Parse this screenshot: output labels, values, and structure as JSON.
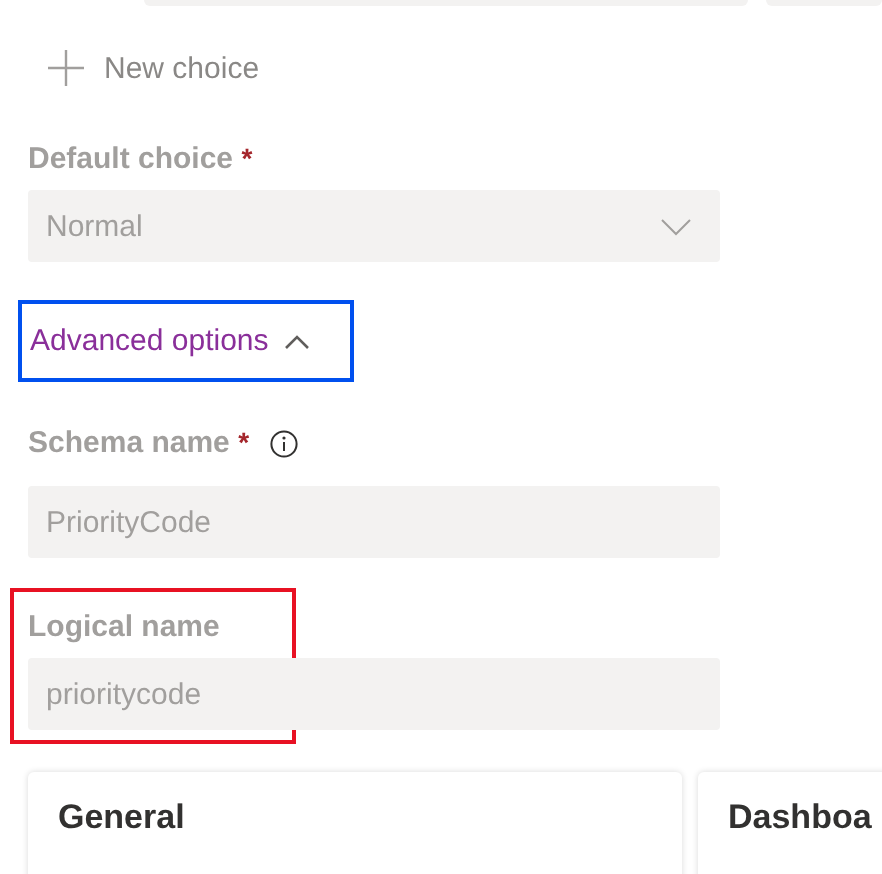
{
  "new_choice": {
    "label": "New choice"
  },
  "default_choice": {
    "label": "Default choice",
    "required_mark": "*",
    "value": "Normal"
  },
  "advanced_options": {
    "label": "Advanced options",
    "expanded": true
  },
  "schema_name": {
    "label": "Schema name",
    "required_mark": "*",
    "value": "PriorityCode"
  },
  "logical_name": {
    "label": "Logical name",
    "value": "prioritycode"
  },
  "cards": [
    {
      "title": "General"
    },
    {
      "title": "Dashboa"
    }
  ]
}
